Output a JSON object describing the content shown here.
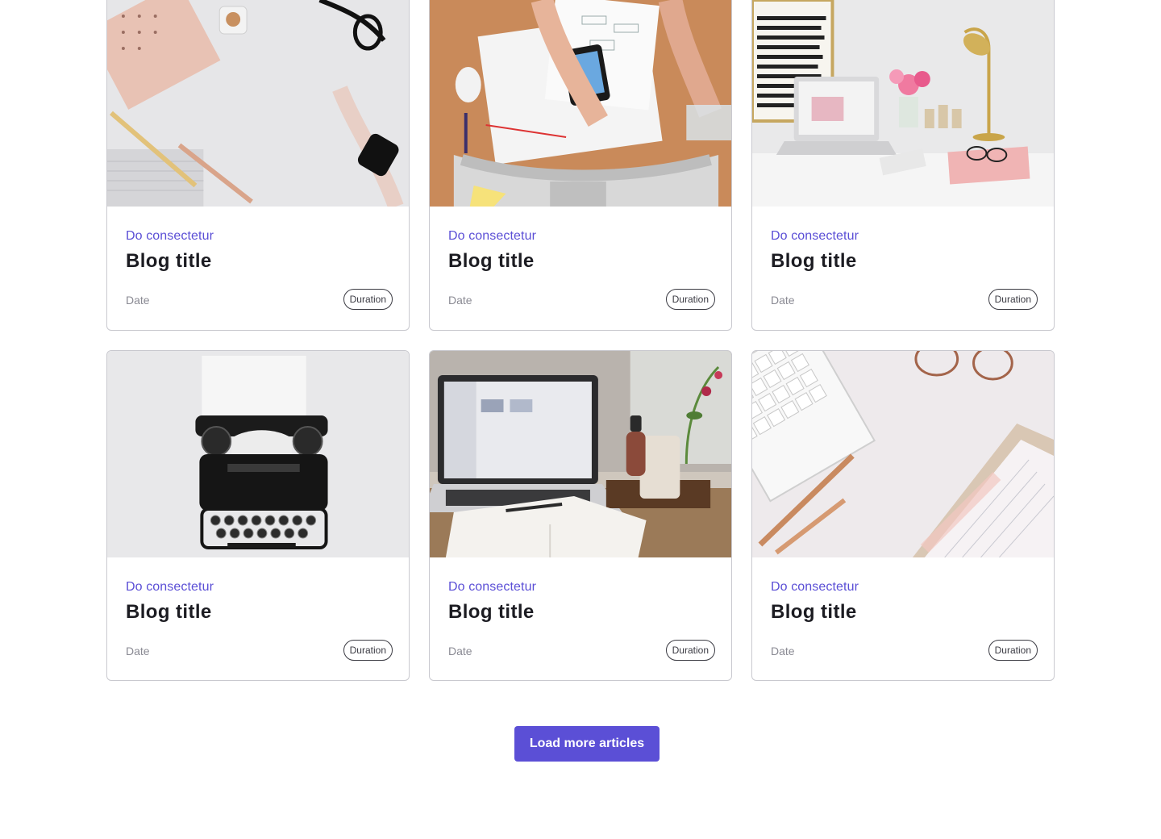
{
  "cards": [
    {
      "category": "Do consectetur",
      "title": "Blog title",
      "date": "Date",
      "duration": "Duration",
      "image": "desk-flatlay-smartwatch"
    },
    {
      "category": "Do consectetur",
      "title": "Blog title",
      "date": "Date",
      "duration": "Duration",
      "image": "hands-drawing-wireframes"
    },
    {
      "category": "Do consectetur",
      "title": "Blog title",
      "date": "Date",
      "duration": "Duration",
      "image": "desk-laptop-flowers"
    },
    {
      "category": "Do consectetur",
      "title": "Blog title",
      "date": "Date",
      "duration": "Duration",
      "image": "vintage-typewriter"
    },
    {
      "category": "Do consectetur",
      "title": "Blog title",
      "date": "Date",
      "duration": "Duration",
      "image": "laptop-notebook-coffee"
    },
    {
      "category": "Do consectetur",
      "title": "Blog title",
      "date": "Date",
      "duration": "Duration",
      "image": "keyboard-pens-notepad"
    }
  ],
  "load_more_label": "Load more articles",
  "colors": {
    "accent": "#5b4fd6",
    "title": "#1c1c22",
    "muted": "#8a8a93",
    "border": "#c9c9cf"
  }
}
